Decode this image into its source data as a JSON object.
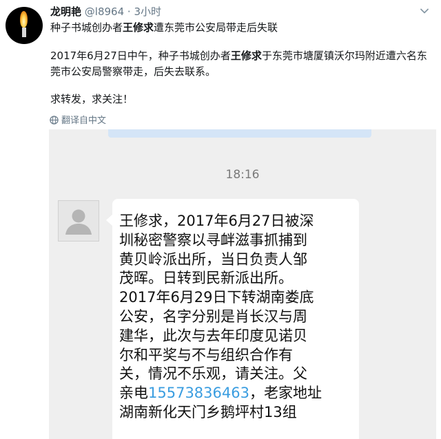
{
  "tweet": {
    "display_name": "龙明艳",
    "handle": "@l8964",
    "separator": "·",
    "time": "3小时",
    "title": {
      "pre": "种子书城创办者",
      "bold": "王修求",
      "post": "遭东莞市公安局带走后失联"
    },
    "body": {
      "pre": "2017年6月27日中午，种子书城创办者",
      "bold": "王修求",
      "post": "于东莞市塘厦镇沃尔玛附近遭六名东莞市公安局警察带走，后失去联系。"
    },
    "appeal": "求转发，求关注！",
    "translate_label": "翻译自中文"
  },
  "screenshot": {
    "time": "18:16",
    "message_lines": [
      "王修求，2017年6月27日被深",
      "圳秘密警察以寻衅滋事抓捕到",
      "黄贝岭派出所，当日负责人邹",
      "茂晖。日转到民新派出所。",
      "2017年6月29日下转湖南娄底",
      "公安，名字分别是肖长汉与周",
      "建华，此次与去年印度见诺贝",
      "尔和平奖与不与组织合作有",
      "关，情况不乐观，请关注。父"
    ],
    "line_father_pre": "亲电",
    "phone": "15573836463",
    "line_father_post": "，老家地址",
    "last_line": "湖南新化天门乡鹅坪村13组"
  },
  "colors": {
    "link": "#3a9de0",
    "muted": "#657786",
    "chat_bg": "#efefef"
  },
  "icons": [
    "candle-avatar",
    "chevron-down-icon",
    "globe-icon",
    "default-user-icon"
  ]
}
